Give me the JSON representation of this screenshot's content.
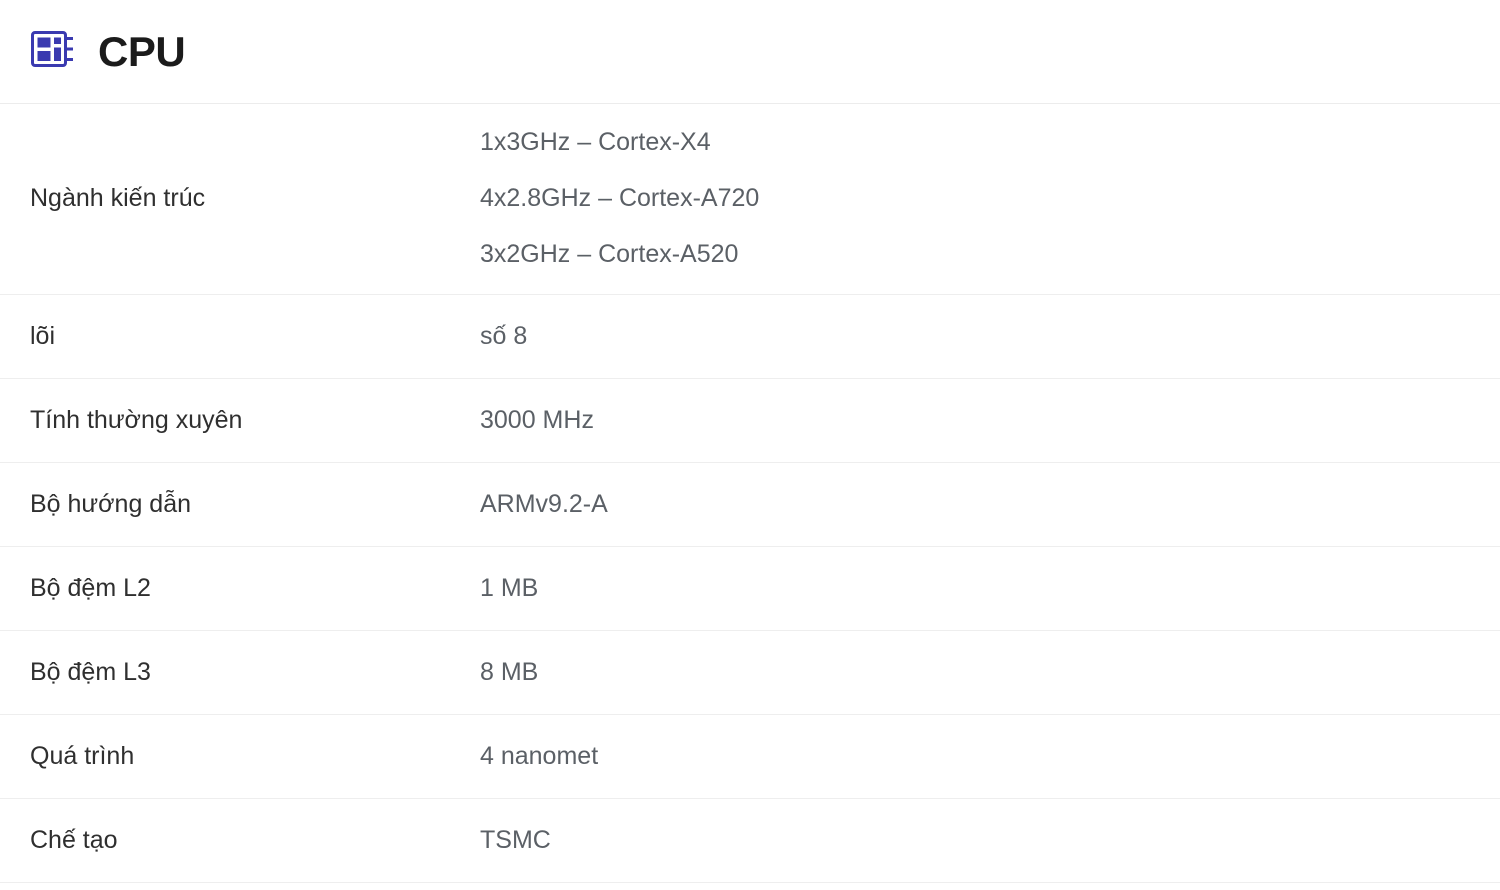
{
  "header": {
    "title": "CPU",
    "icon": "cpu-chip-icon",
    "icon_color": "#3a3ab0"
  },
  "colors": {
    "accent": "#3a3ab0",
    "label_text": "#2f2f2f",
    "value_text": "#5b6066",
    "divider": "#eeeeee",
    "background": "#ffffff"
  },
  "rows": [
    {
      "label": "Ngành kiến trúc",
      "value_lines": [
        "1x3GHz – Cortex-X4",
        "4x2.8GHz – Cortex-A720",
        "3x2GHz – Cortex-A520"
      ]
    },
    {
      "label": "lõi",
      "value_lines": [
        "số 8"
      ]
    },
    {
      "label": "Tính thường xuyên",
      "value_lines": [
        "3000 MHz"
      ]
    },
    {
      "label": "Bộ hướng dẫn",
      "value_lines": [
        "ARMv9.2-A"
      ]
    },
    {
      "label": "Bộ đệm L2",
      "value_lines": [
        "1 MB"
      ]
    },
    {
      "label": "Bộ đệm L3",
      "value_lines": [
        "8 MB"
      ]
    },
    {
      "label": "Quá trình",
      "value_lines": [
        "4 nanomet"
      ]
    },
    {
      "label": "Chế tạo",
      "value_lines": [
        "TSMC"
      ]
    }
  ]
}
